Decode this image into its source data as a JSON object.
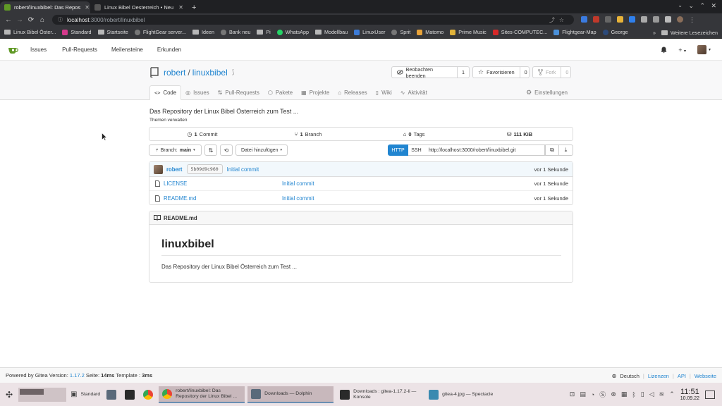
{
  "browser": {
    "tabs": [
      {
        "title": "robert/linuxbibel: Das Repos",
        "active": true
      },
      {
        "title": "Linux Bibel Oesterreich • Neu",
        "active": false
      }
    ],
    "address": {
      "host": "localhost",
      "path": ":3000/robert/linuxbibel"
    },
    "bookmarks": [
      {
        "label": "Linux Bibel Öster...",
        "icon": "folder-icon"
      },
      {
        "label": "Standard",
        "icon": "bookmark-site-icon",
        "color": "#d63a8c"
      },
      {
        "label": "Startseite",
        "icon": "folder-icon"
      },
      {
        "label": "FlightGear server...",
        "icon": "globe-icon",
        "color": "#777777"
      },
      {
        "label": "Ideen",
        "icon": "folder-icon"
      },
      {
        "label": "Bank neu",
        "icon": "globe-icon",
        "color": "#777777"
      },
      {
        "label": "Pi",
        "icon": "folder-icon"
      },
      {
        "label": "WhatsApp",
        "icon": "whatsapp-icon",
        "color": "#25d366"
      },
      {
        "label": "Modellbau",
        "icon": "folder-icon"
      },
      {
        "label": "LinuxUser",
        "icon": "linuxuser-icon",
        "color": "#3c7bd6"
      },
      {
        "label": "Sprit",
        "icon": "globe-icon",
        "color": "#777777"
      },
      {
        "label": "Matomo",
        "icon": "matomo-icon",
        "color": "#e8a33a"
      },
      {
        "label": "Prime Music",
        "icon": "prime-music-icon",
        "color": "#e0b23a"
      },
      {
        "label": "Sites-COMPUTEC...",
        "icon": "computec-icon",
        "color": "#d62828"
      },
      {
        "label": "Flightgear-Map",
        "icon": "map-icon",
        "color": "#4a90d9"
      },
      {
        "label": "George",
        "icon": "george-icon",
        "color": "#2c4a7a"
      }
    ],
    "more_bookmarks": "Weitere Lesezeichen"
  },
  "gitea": {
    "nav": [
      "Issues",
      "Pull-Requests",
      "Meilensteine",
      "Erkunden"
    ],
    "repo": {
      "owner": "robert",
      "name": "linuxbibel"
    },
    "buttons": {
      "watch": {
        "label": "Beobachten beenden",
        "count": "1"
      },
      "star": {
        "label": "Favorisieren",
        "count": "0"
      },
      "fork": {
        "label": "Fork",
        "count": "0"
      }
    },
    "tabs": [
      {
        "label": "Code",
        "icon": "code-icon",
        "active": true
      },
      {
        "label": "Issues",
        "icon": "issue-icon",
        "active": false
      },
      {
        "label": "Pull-Requests",
        "icon": "pull-request-icon",
        "active": false
      },
      {
        "label": "Pakete",
        "icon": "package-icon",
        "active": false
      },
      {
        "label": "Projekte",
        "icon": "project-icon",
        "active": false
      },
      {
        "label": "Releases",
        "icon": "tag-icon",
        "active": false
      },
      {
        "label": "Wiki",
        "icon": "book-icon",
        "active": false
      },
      {
        "label": "Aktivität",
        "icon": "pulse-icon",
        "active": false
      }
    ],
    "settings_tab": "Einstellungen",
    "description": "Das Repository der Linux Bibel Österreich zum Test ...",
    "topics_link": "Themen verwalten",
    "stats": {
      "commits_num": "1",
      "commits_label": "Commit",
      "branches_num": "1",
      "branches_label": "Branch",
      "tags_num": "0",
      "tags_label": "Tags",
      "size": "111 KiB"
    },
    "controls": {
      "branch_prefix": "Branch:",
      "branch_name": "main",
      "add_file": "Datei hinzufügen",
      "http": "HTTP",
      "ssh": "SSH",
      "clone_url": "http://localhost:3000/robert/linuxbibel.git"
    },
    "last_commit": {
      "author": "robert",
      "sha": "5b09d9c960",
      "message": "Initial commit",
      "time": "vor 1 Sekunde"
    },
    "files": [
      {
        "name": "LICENSE",
        "commit": "Initial commit",
        "time": "vor 1 Sekunde"
      },
      {
        "name": "README.md",
        "commit": "Initial commit",
        "time": "vor 1 Sekunde"
      }
    ],
    "readme": {
      "filename": "README.md",
      "heading": "linuxbibel",
      "text": "Das Repository der Linux Bibel Österreich zum Test ..."
    },
    "footer": {
      "powered": "Powered by Gitea Version:",
      "version": "1.17.2",
      "page_label": "Seite:",
      "page_time": "14ms",
      "template_label": "Template :",
      "template_time": "3ms",
      "language": "Deutsch",
      "licenses": "Lizenzen",
      "api": "API",
      "website": "Webseite"
    }
  },
  "taskbar": {
    "tasks": [
      {
        "label": "Standard",
        "icon": "chrome-profile-icon",
        "color": "#4a4a4a"
      },
      {
        "label": "robert/linuxbibel: Das Repository der Linux Bibel ...",
        "icon": "chrome-icon",
        "color": "#4285f4",
        "active": true
      },
      {
        "label": "Downloads — Dolphin",
        "icon": "dolphin-icon",
        "color": "#5a6a7a",
        "active": true
      },
      {
        "label": "Downloads : gitea-1.17.2-li — Konsole",
        "icon": "konsole-icon",
        "color": "#2a2a2a"
      },
      {
        "label": "gitea-4.jpg — Spectacle",
        "icon": "spectacle-icon",
        "color": "#3a8ab0"
      }
    ],
    "time": "11:51",
    "date": "10.09.22"
  },
  "colors": {
    "accent": "#2185d0",
    "gitea_green": "#609926"
  }
}
